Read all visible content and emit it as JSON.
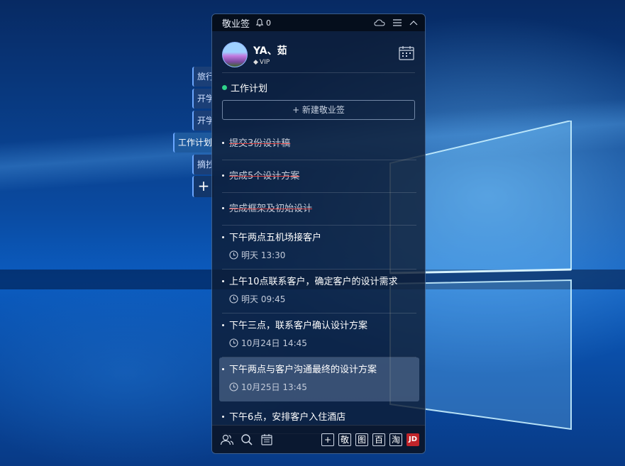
{
  "app": {
    "title": "敬业签",
    "notification_count": "0"
  },
  "user": {
    "name": "YA、茹",
    "badge": "VIP"
  },
  "side_tabs": [
    {
      "label": "旅行"
    },
    {
      "label": "开学"
    },
    {
      "label": "开学"
    },
    {
      "label": "工作计划",
      "active": true
    },
    {
      "label": "摘抄"
    }
  ],
  "side_add_label": "+",
  "group": {
    "title": "工作计划",
    "new_button_label": "+ 新建敬业签"
  },
  "notes": [
    {
      "text": "提交3份设计稿",
      "done": true
    },
    {
      "text": "完成5个设计方案",
      "done": true
    },
    {
      "text": "完成框架及初始设计",
      "done": true
    },
    {
      "text": "下午两点五机场接客户",
      "time": "明天 13:30"
    },
    {
      "text": "上午10点联系客户，确定客户的设计需求",
      "time": "明天 09:45"
    },
    {
      "text": "下午三点，联系客户确认设计方案",
      "time": "10月24日 14:45"
    },
    {
      "text": "下午两点与客户沟通最终的设计方案",
      "time": "10月25日 13:45",
      "highlighted": true
    },
    {
      "text": "下午6点，安排客户入住酒店"
    }
  ],
  "bottom_buttons": [
    "+",
    "敬",
    "图",
    "百",
    "淘",
    "JD"
  ],
  "colors": {
    "accent_green": "#2fd38a",
    "strike_red": "#e04040",
    "jd_red": "#c0242a"
  },
  "icons": [
    "bell-icon",
    "cloud-icon",
    "menu-icon",
    "collapse-icon",
    "calendar-icon",
    "clock-icon",
    "contacts-icon",
    "search-icon",
    "notes-icon"
  ]
}
